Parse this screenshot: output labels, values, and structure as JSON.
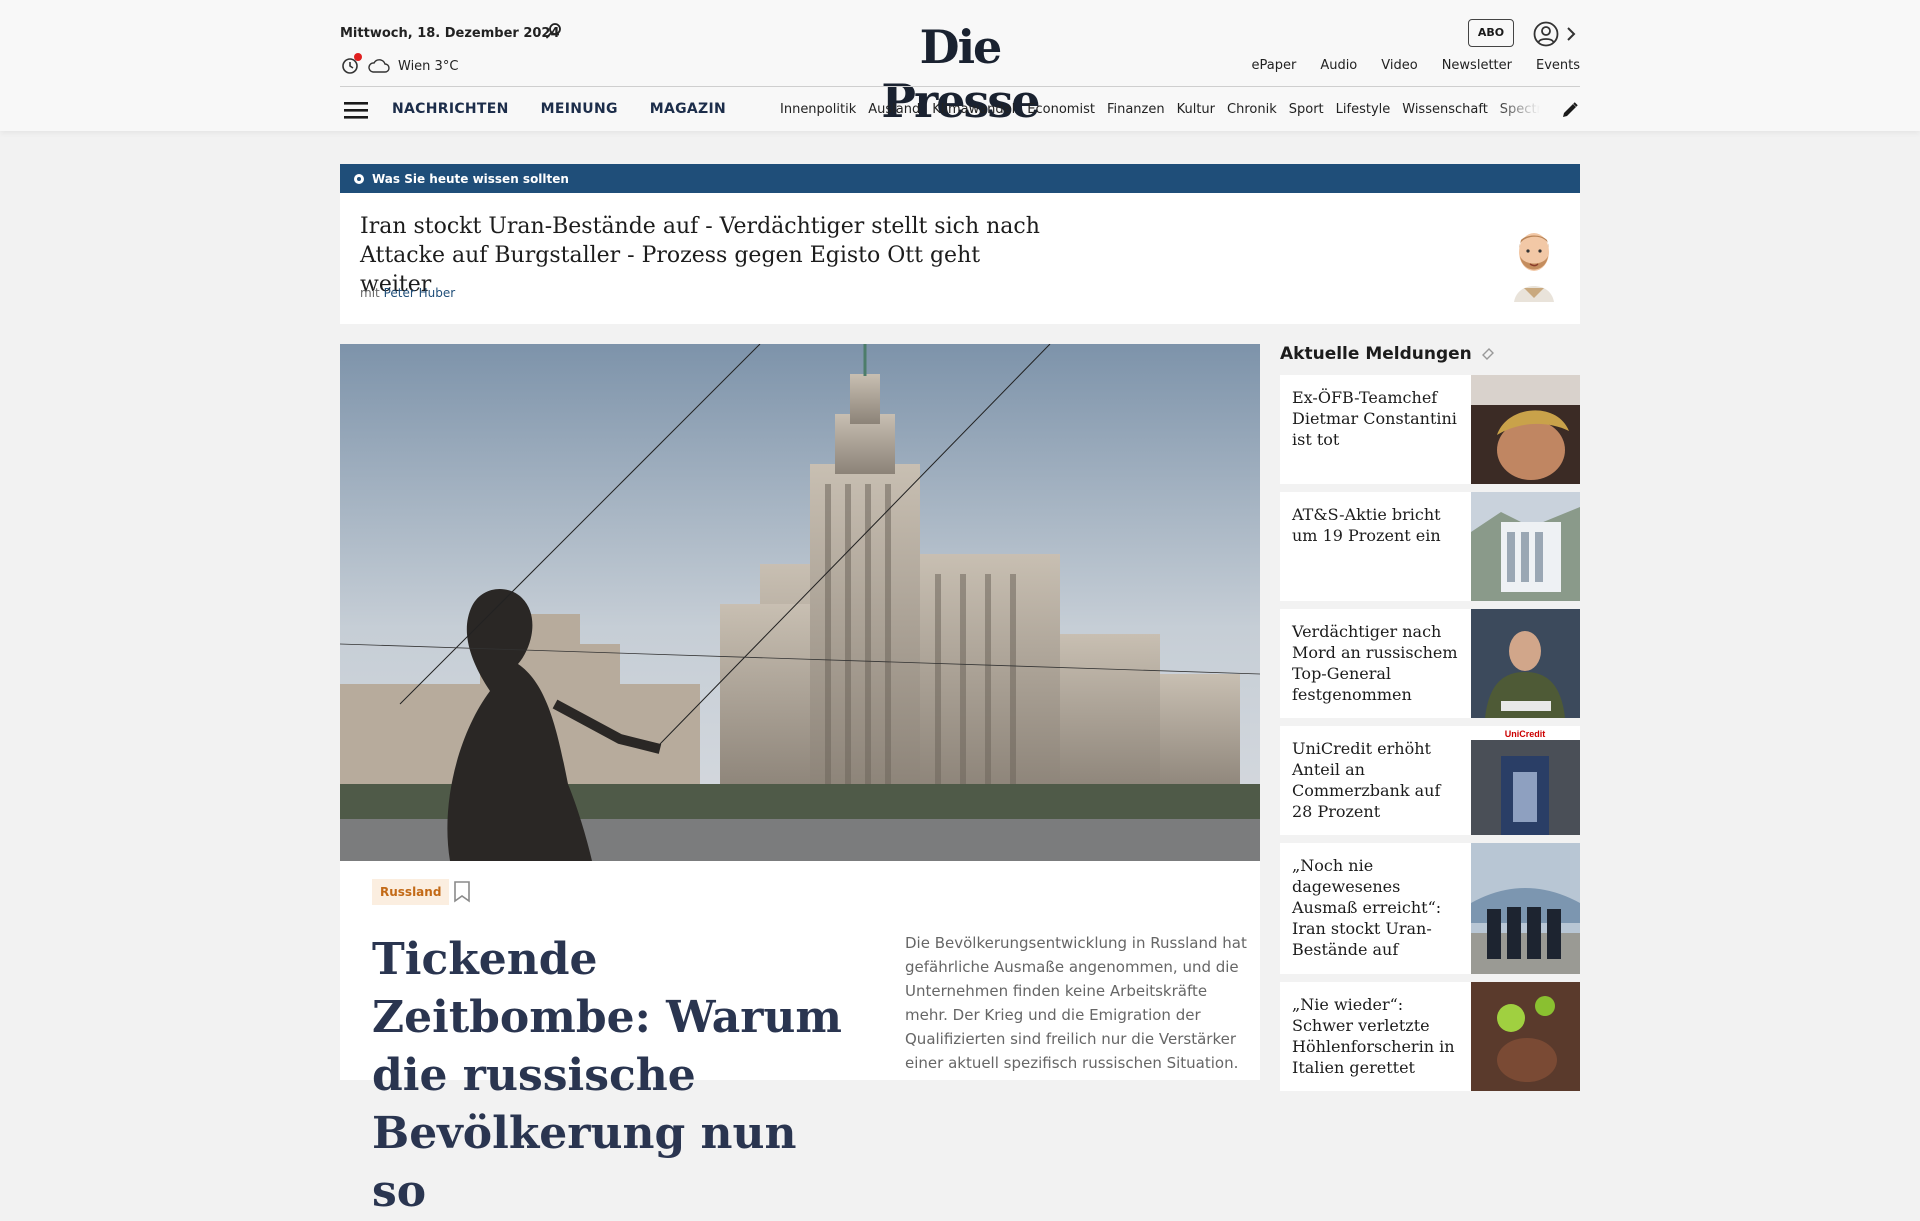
{
  "header": {
    "date": "Mittwoch, 18. Dezember 2024",
    "weather": "Wien 3°C",
    "logo": "Die Presse",
    "abo": "ABO",
    "top_links": [
      "ePaper",
      "Audio",
      "Video",
      "Newsletter",
      "Events"
    ],
    "main_nav": [
      "NACHRICHTEN",
      "MEINUNG",
      "MAGAZIN"
    ],
    "sub_nav": [
      "Innenpolitik",
      "Ausland",
      "Klimawandel",
      "Economist",
      "Finanzen",
      "Kultur",
      "Chronik",
      "Sport",
      "Lifestyle",
      "Wissenschaft",
      "Spectrum"
    ]
  },
  "briefing": {
    "label": "Was Sie heute wissen sollten",
    "title": "Iran stockt Uran-Bestände auf - Verdächtiger stellt sich nach Attacke auf Burgstaller - Prozess gegen Egisto Ott geht weiter",
    "by_prefix": "mit",
    "author": "Peter Huber"
  },
  "hero": {
    "tag": "Russland",
    "title": "Tickende Zeitbombe: Warum die russische Bevölkerung nun so",
    "lead": "Die Bevölkerungsentwicklung in Russland hat gefährliche Ausmaße angenommen, und die Unternehmen finden keine Arbeitskräfte mehr. Der Krieg und die Emigration der Qualifizierten sind freilich nur die Verstärker einer aktuell spezifisch russischen Situation."
  },
  "aside": {
    "title": "Aktuelle Meldungen",
    "items": [
      {
        "title": "Ex-ÖFB-Teamchef Dietmar Constantini ist tot"
      },
      {
        "title": "AT&S-Aktie bricht um 19 Prozent ein"
      },
      {
        "title": "Verdächtiger nach Mord an russischem Top-General festgenommen"
      },
      {
        "title": "UniCredit erhöht Anteil an Commerzbank auf 28 Prozent"
      },
      {
        "title": "„Noch nie dagewesenes Ausmaß erreicht“: Iran stockt Uran-Bestände auf"
      },
      {
        "title": "„Nie wieder“: Schwer verletzte Höhlenforscherin in Italien gerettet"
      }
    ]
  },
  "colors": {
    "brand_blue": "#1f4e79",
    "nav_text": "#1c2d4a",
    "tag_orange": "#c36a17"
  }
}
